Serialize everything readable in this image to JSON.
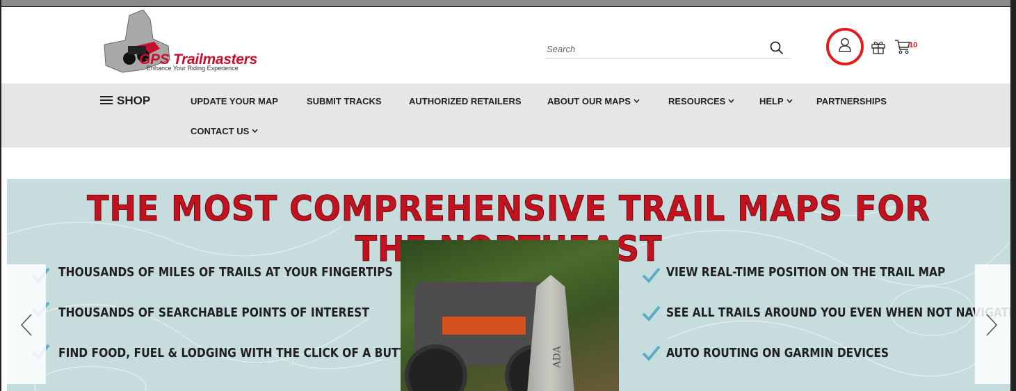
{
  "brand": {
    "name": "GPS Trailmasters",
    "tagline": "Enhance Your Riding Experience"
  },
  "search": {
    "placeholder": "Search"
  },
  "header_icons": {
    "account": "user-icon",
    "gift": "gift-icon",
    "cart": "cart-icon",
    "cart_count": "10"
  },
  "nav": {
    "shop_label": "SHOP",
    "items": [
      "UPDATE YOUR MAP",
      "SUBMIT TRACKS",
      "AUTHORIZED RETAILERS",
      "ABOUT OUR MAPS",
      "RESOURCES",
      "HELP",
      "PARTNERSHIPS",
      "CONTACT US"
    ]
  },
  "hero": {
    "title": "THE MOST COMPREHENSIVE TRAIL MAPS FOR THE NORTHEAST",
    "features_left": [
      "THOUSANDS OF MILES OF TRAILS AT YOUR FINGERTIPS",
      "THOUSANDS OF SEARCHABLE POINTS OF INTEREST",
      "FIND FOOD, FUEL & LODGING WITH THE CLICK OF A BUTTON"
    ],
    "features_right": [
      "VIEW REAL-TIME POSITION ON THE TRAIL MAP",
      "SEE ALL TRAILS AROUND YOU EVEN WHEN NOT NAVIGATING",
      "AUTO ROUTING ON GARMIN DEVICES"
    ],
    "photo_text": "ADA"
  },
  "colors": {
    "accent_red": "#c0121f",
    "highlight_circle": "#e31b1b",
    "nav_bg": "#e6e6e6",
    "hero_bg": "#c7dcdc",
    "check_teal": "#5aaec4"
  }
}
